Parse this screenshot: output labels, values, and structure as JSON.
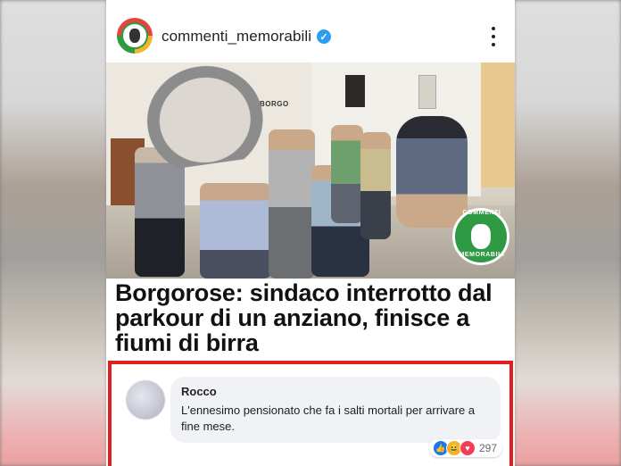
{
  "post": {
    "username": "commenti_memorabili",
    "verified_icon": "verified-check-icon",
    "more_icon": "more-vertical-icon"
  },
  "photo": {
    "sign_text": "BORGO",
    "badge_top": "COMMENTI",
    "badge_bottom": "MEMORABILI"
  },
  "headline": "Borgorose: sindaco interrotto dal parkour di un anziano, finisce a fiumi di birra",
  "comment": {
    "author": "Rocco",
    "text": "L'ennesimo pensionato che fa i salti mortali per arrivare a fine mese.",
    "reaction_count": "297",
    "reactions": [
      "like-icon",
      "haha-icon",
      "love-icon"
    ]
  },
  "colors": {
    "highlight_border": "#e2201f",
    "verified": "#2b9ef0",
    "brand_green": "#2f9a44"
  }
}
